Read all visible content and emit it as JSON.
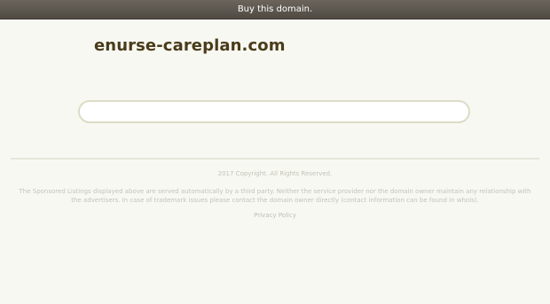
{
  "topbar": {
    "buy_label": "Buy this domain."
  },
  "main": {
    "domain_name": "enurse-careplan.com",
    "search": {
      "value": "",
      "placeholder": ""
    }
  },
  "footer": {
    "copyright": "2017 Copyright. All Rights Reserved.",
    "disclaimer": "The Sponsored Listings displayed above are served automatically by a third party. Neither the service provider nor the domain owner maintain any relationship with the advertisers. In case of trademark issues please contact the domain owner directly (contact information can be found in whois).",
    "privacy_label": "Privacy Policy"
  },
  "colors": {
    "background": "#f8f8f3",
    "topbar": "#5c574f",
    "title": "#4a3c1a",
    "footer_text": "#c3c3b8"
  }
}
